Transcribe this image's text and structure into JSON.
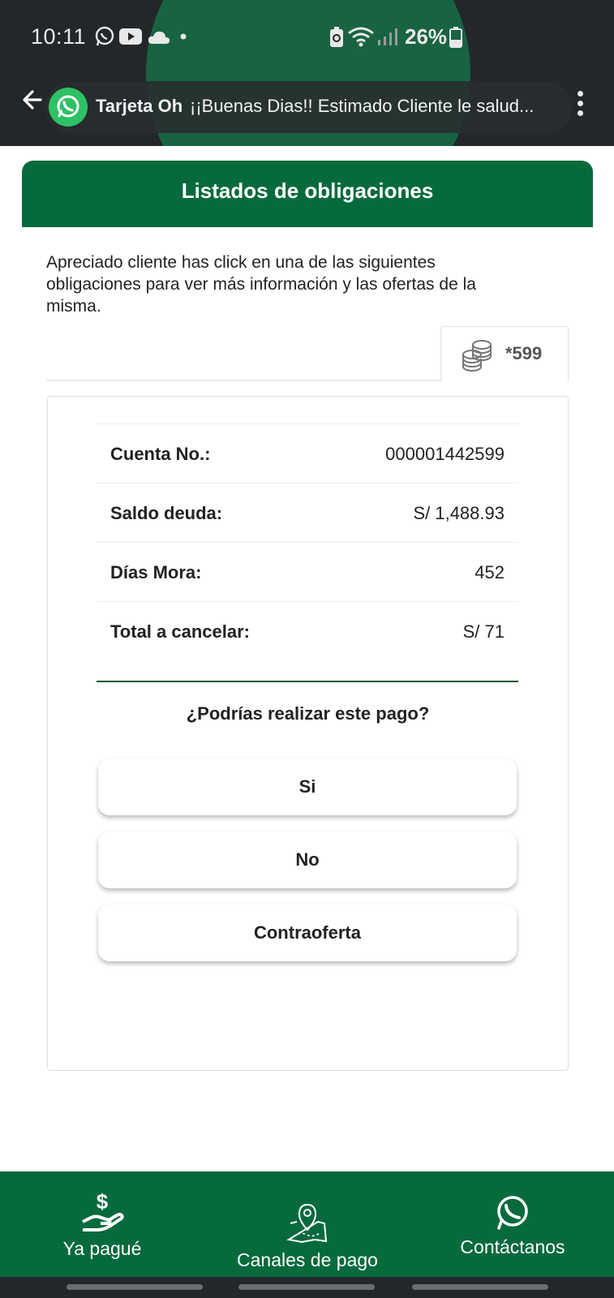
{
  "status_bar": {
    "time": "10:11",
    "battery": "26%",
    "icons": [
      "whatsapp-icon",
      "youtube-icon",
      "cloud-icon",
      "dot-icon",
      "battery-saver-icon",
      "wifi-icon",
      "signal-icon",
      "battery-icon"
    ]
  },
  "chat_bar": {
    "title": "Tarjeta Oh",
    "message": "¡¡Buenas Dias!! Estimado Cliente le salud..."
  },
  "header": {
    "title": "Listados de obligaciones"
  },
  "intro_text": "Apreciado cliente has click en una de las siguientes obligaciones para ver más información y las ofertas de la misma.",
  "tab": {
    "number": "*599",
    "icon": "coins-icon"
  },
  "details": {
    "rows": [
      {
        "label": "Cuenta No.:",
        "value": "000001442599"
      },
      {
        "label": "Saldo deuda:",
        "value": "S/ 1,488.93"
      },
      {
        "label": "Días Mora:",
        "value": "452"
      },
      {
        "label": "Total a cancelar:",
        "value": "S/ 71"
      }
    ],
    "question": "¿Podrías realizar este pago?",
    "buttons": {
      "yes": "Si",
      "no": "No",
      "counteroffer": "Contraoferta"
    }
  },
  "bottom_nav": {
    "items": [
      {
        "label": "Ya pagué",
        "icon": "hand-dollar-icon"
      },
      {
        "label": "Canales de pago",
        "icon": "map-pin-icon"
      },
      {
        "label": "Contáctanos",
        "icon": "whatsapp-icon"
      }
    ]
  },
  "colors": {
    "brand_green": "#076a3d",
    "status_bar": "#23272a",
    "whatsapp_green": "#2fc165"
  }
}
